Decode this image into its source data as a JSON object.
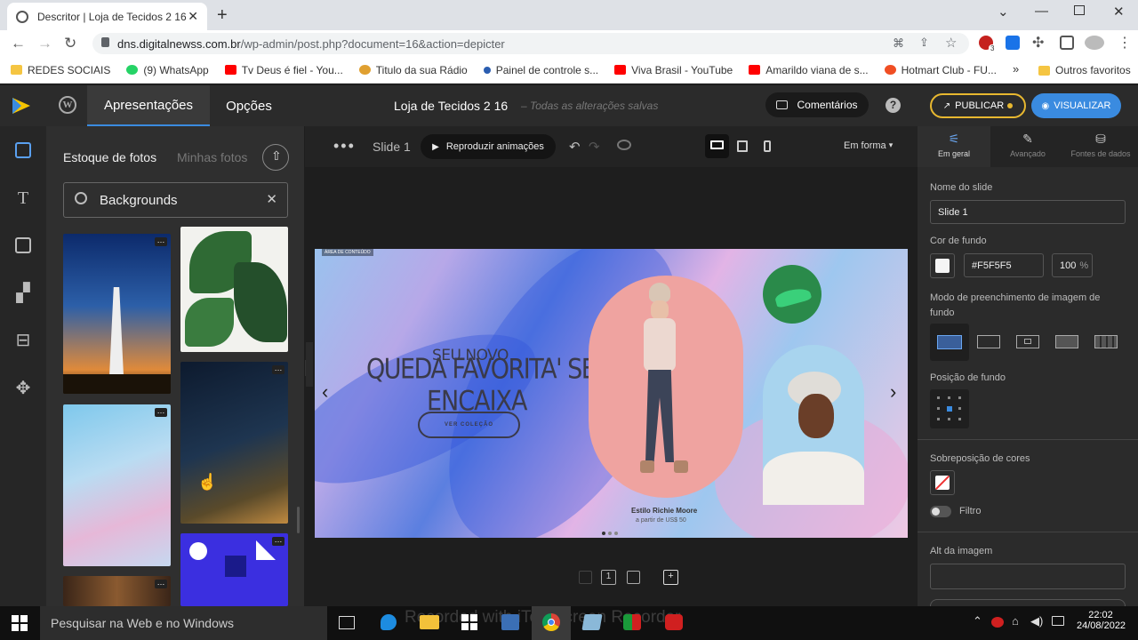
{
  "browser": {
    "tab_title": "Descritor | Loja de Tecidos 2 16",
    "url_host": "dns.digitalnewss.com.br",
    "url_path": "/wp-admin/post.php?document=16&action=depicter",
    "bookmarks": [
      "REDES SOCIAIS",
      "(9) WhatsApp",
      "Tv Deus é fiel - You...",
      "Titulo da sua Rádio",
      "Painel de controle s...",
      "Viva Brasil - YouTube",
      "Amarildo viana de s...",
      "Hotmart Club - FU..."
    ],
    "bookmarks_overflow": "»",
    "other_bookmarks": "Outros favoritos",
    "ext_badge": "3"
  },
  "app": {
    "tabs": [
      "Apresentações",
      "Opções"
    ],
    "doc_title": "Loja de Tecidos 2 16",
    "doc_status": "– Todas as alterações salvas",
    "comments_label": "Comentários",
    "help_label": "?",
    "publish_label": "PUBLICAR",
    "preview_label": "VISUALIZAR"
  },
  "photos": {
    "tab_stock": "Estoque de fotos",
    "tab_mine": "Minhas fotos",
    "search_value": "Backgrounds"
  },
  "canvas": {
    "slide_label": "Slide 1",
    "play_label": "Reproduzir animações",
    "fit_label": "Em forma",
    "area_tag": "ÁREA DE CONTEÚDO",
    "slide_small": "SEU NOVO",
    "slide_headline_1": "QUEDA FAVORITA' SE",
    "slide_headline_2": "ENCAIXA",
    "slide_button": "VER COLEÇÃO",
    "caption_title": "Estilo Richie Moore",
    "caption_sub": "a partir de US$ 50",
    "nav_prev": "‹",
    "nav_next": "›",
    "bottom_counter": "1"
  },
  "inspector": {
    "tabs": [
      "Em geral",
      "Avançado",
      "Fontes de dados"
    ],
    "slide_name_label": "Nome do slide",
    "slide_name_value": "Slide 1",
    "bg_color_label": "Cor de fundo",
    "bg_color_value": "#F5F5F5",
    "bg_opacity": "100",
    "bg_opacity_unit": "%",
    "fill_mode_label": "Modo de preenchimento de imagem de fundo",
    "position_label": "Posição de fundo",
    "overlay_label": "Sobreposição de cores",
    "filter_label": "Filtro",
    "alt_label": "Alt da imagem"
  },
  "taskbar": {
    "search_placeholder": "Pesquisar na Web e no Windows",
    "time": "22:02",
    "date": "24/08/2022",
    "watermark": "Recorded with iTop Screen Recorder"
  }
}
